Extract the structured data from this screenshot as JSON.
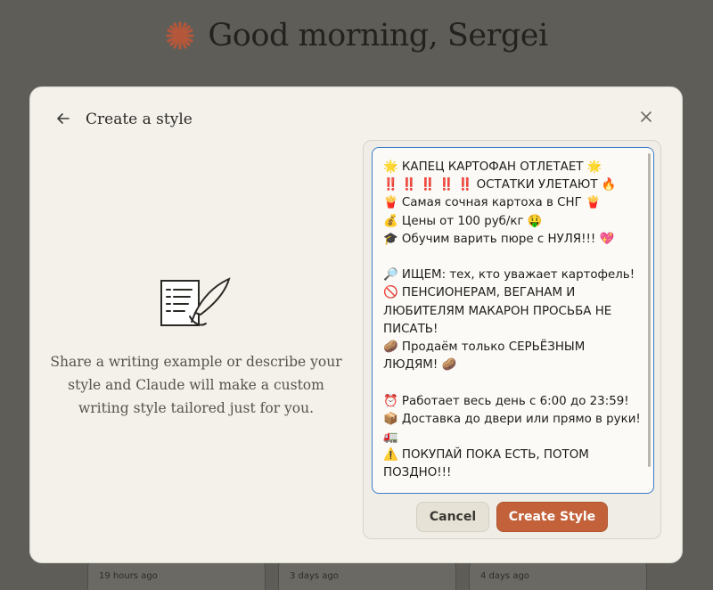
{
  "background": {
    "greeting": "Good morning, Sergei",
    "cards": [
      {
        "timestamp": "19 hours ago"
      },
      {
        "timestamp": "3 days ago"
      },
      {
        "timestamp": "4 days ago"
      }
    ]
  },
  "modal": {
    "title": "Create a style",
    "description": "Share a writing example or describe your style and Claude will make a custom writing style tailored just for you.",
    "textarea_value": "🌟 КАПЕЦ КАРТОФАН ОТЛЕТАЕТ 🌟\n‼️ ‼️ ‼️ ‼️ ‼️ ОСТАТКИ УЛЕТАЮТ 🔥\n🍟 Самая сочная картоха в СНГ 🍟\n💰 Цены от 100 руб/кг 🤑\n🎓 Обучим варить пюре с НУЛЯ!!! 💖\n\n🔎 ИЩЕМ: тех, кто уважает картофель!\n🚫 ПЕНСИОНЕРАМ, ВЕГАНАМ И ЛЮБИТЕЛЯМ МАКАРОН ПРОСЬБА НЕ ПИСАТЬ!\n🥔 Продаём только СЕРЬЁЗНЫМ ЛЮДЯМ! 🥔\n\n⏰ Работает весь день с 6:00 до 23:59!\n📦 Доставка до двери или прямо в руки! 🚛\n⚠️ ПОКУПАЙ ПОКА ЕСТЬ, ПОТОМ ПОЗДНО!!!\n\n📩 Пиши сюда: @PotatoKingDealer",
    "cancel_label": "Cancel",
    "create_label": "Create Style"
  },
  "colors": {
    "accent": "#c2613a",
    "focus_border": "#3d7ec9",
    "modal_bg": "#f3f1ea",
    "overlay": "#5f5d58"
  },
  "icons": {
    "back": "arrow-left-icon",
    "close": "close-icon",
    "logo": "claude-spark-icon",
    "illustration": "writing-quill-icon"
  }
}
